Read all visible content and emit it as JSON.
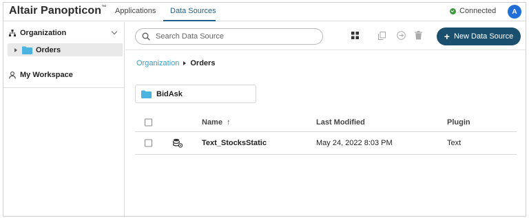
{
  "app": {
    "name": "Altair Panopticon",
    "trademark": "™"
  },
  "nav": {
    "tabs": [
      {
        "label": "Applications",
        "active": false
      },
      {
        "label": "Data Sources",
        "active": true
      }
    ]
  },
  "status": {
    "label": "Connected",
    "color": "#3a9a3a"
  },
  "user": {
    "avatar_initial": "A"
  },
  "sidebar": {
    "organization_label": "Organization",
    "items": [
      {
        "label": "Orders",
        "selected": true
      }
    ],
    "workspace_label": "My Workspace"
  },
  "toolbar": {
    "search_placeholder": "Search Data Source",
    "new_button_label": "New Data Source",
    "new_button_color": "#1b4f6e"
  },
  "breadcrumb": {
    "root": "Organization",
    "current": "Orders"
  },
  "folders": [
    {
      "name": "BidAsk"
    }
  ],
  "table": {
    "headers": {
      "name": "Name",
      "last_modified": "Last Modified",
      "plugin": "Plugin"
    },
    "sort_indicator": "↑",
    "rows": [
      {
        "name": "Text_StocksStatic",
        "last_modified": "May 24, 2022 8:03 PM",
        "plugin": "Text"
      }
    ]
  }
}
